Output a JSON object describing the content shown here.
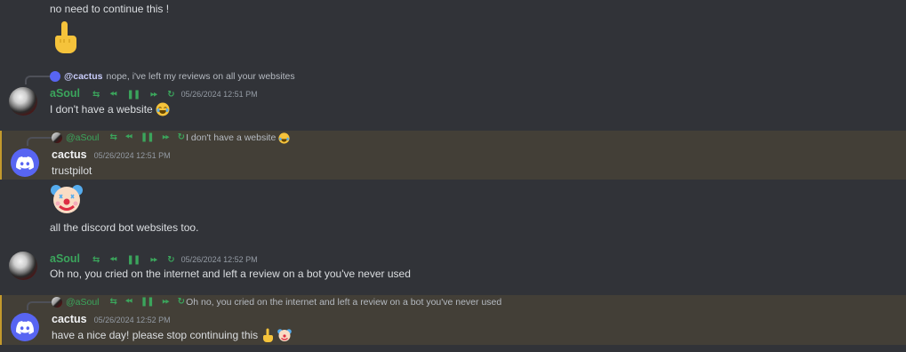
{
  "messages": {
    "m0": {
      "text": "no need to continue this !",
      "emoji": "middle-finger"
    },
    "m1": {
      "reply_mention": "@cactus",
      "reply_text": "nope, i've left my reviews on all your websites",
      "author": "aSoul",
      "timestamp": "05/26/2024 12:51 PM",
      "text": "I don't have a website",
      "emoji": "joy"
    },
    "m2": {
      "reply_mention": "@aSoul",
      "reply_text": "I don't have a website",
      "author": "cactus",
      "timestamp": "05/26/2024 12:51 PM",
      "text": "trustpilot"
    },
    "m3": {
      "emoji": "clown"
    },
    "m4": {
      "text": "all the discord bot websites too."
    },
    "m5": {
      "author": "aSoul",
      "timestamp": "05/26/2024 12:52 PM",
      "text": "Oh no, you cried on the internet and left a review on a bot you've never used"
    },
    "m6": {
      "reply_mention": "@aSoul",
      "reply_text": "Oh no, you cried on the internet and left a review on a bot you've never used",
      "author": "cactus",
      "timestamp": "05/26/2024 12:52 PM",
      "text": "have a nice day! please stop continuing this",
      "emojis": [
        "middle-finger",
        "clown"
      ]
    }
  },
  "controls": {
    "shuffle": "⇆",
    "previous": "⏪︎",
    "pause": "❚❚",
    "next": "⏩︎",
    "loop": "↻"
  },
  "colors": {
    "background": "#313338",
    "highlight": "#433f37",
    "highlight_border": "#c49a2c",
    "asoul_name": "#3ba55c",
    "discord_blurple": "#5865f2"
  }
}
